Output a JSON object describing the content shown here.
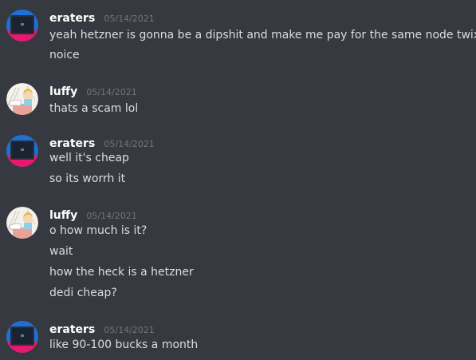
{
  "groups": [
    {
      "author": "eraters",
      "timestamp": "05/14/2021",
      "avatar": "eraters-avatar",
      "lines": [
        "yeah hetzner is gonna be a dipshit and make me pay for the same node twixe",
        "noice"
      ]
    },
    {
      "author": "luffy",
      "timestamp": "05/14/2021",
      "avatar": "luffy-avatar",
      "lines": [
        "thats a scam lol"
      ]
    },
    {
      "author": "eraters",
      "timestamp": "05/14/2021",
      "avatar": "eraters-avatar",
      "lines": [
        "well it's cheap",
        "so its worrh it"
      ]
    },
    {
      "author": "luffy",
      "timestamp": "05/14/2021",
      "avatar": "luffy-avatar",
      "lines": [
        "o how much is it?",
        "wait",
        "how the heck is a hetzner",
        "dedi cheap?"
      ]
    },
    {
      "author": "eraters",
      "timestamp": "05/14/2021",
      "avatar": "eraters-avatar",
      "lines": [
        "like 90-100 bucks a month"
      ]
    }
  ],
  "colors": {
    "background": "#36393f",
    "username": "#ffffff",
    "timestamp": "#72767d",
    "text": "#dcddde"
  }
}
